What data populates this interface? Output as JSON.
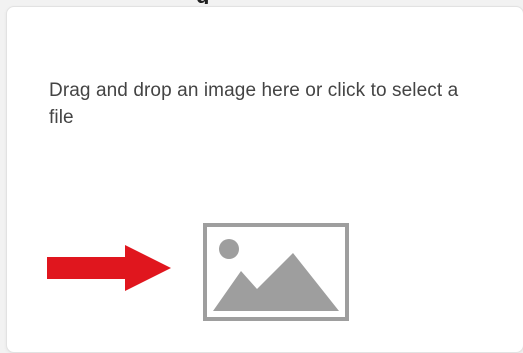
{
  "dropzone": {
    "instruction_text": "Drag and drop an image here or click to select a file",
    "heading_fragment": "g"
  },
  "icons": {
    "pointer": "red-right-arrow-icon",
    "placeholder": "image-placeholder-icon"
  },
  "colors": {
    "arrow": "#e0161e",
    "icon_gray": "#9e9e9e",
    "text": "#444444",
    "card_border": "#e2e2e2"
  }
}
